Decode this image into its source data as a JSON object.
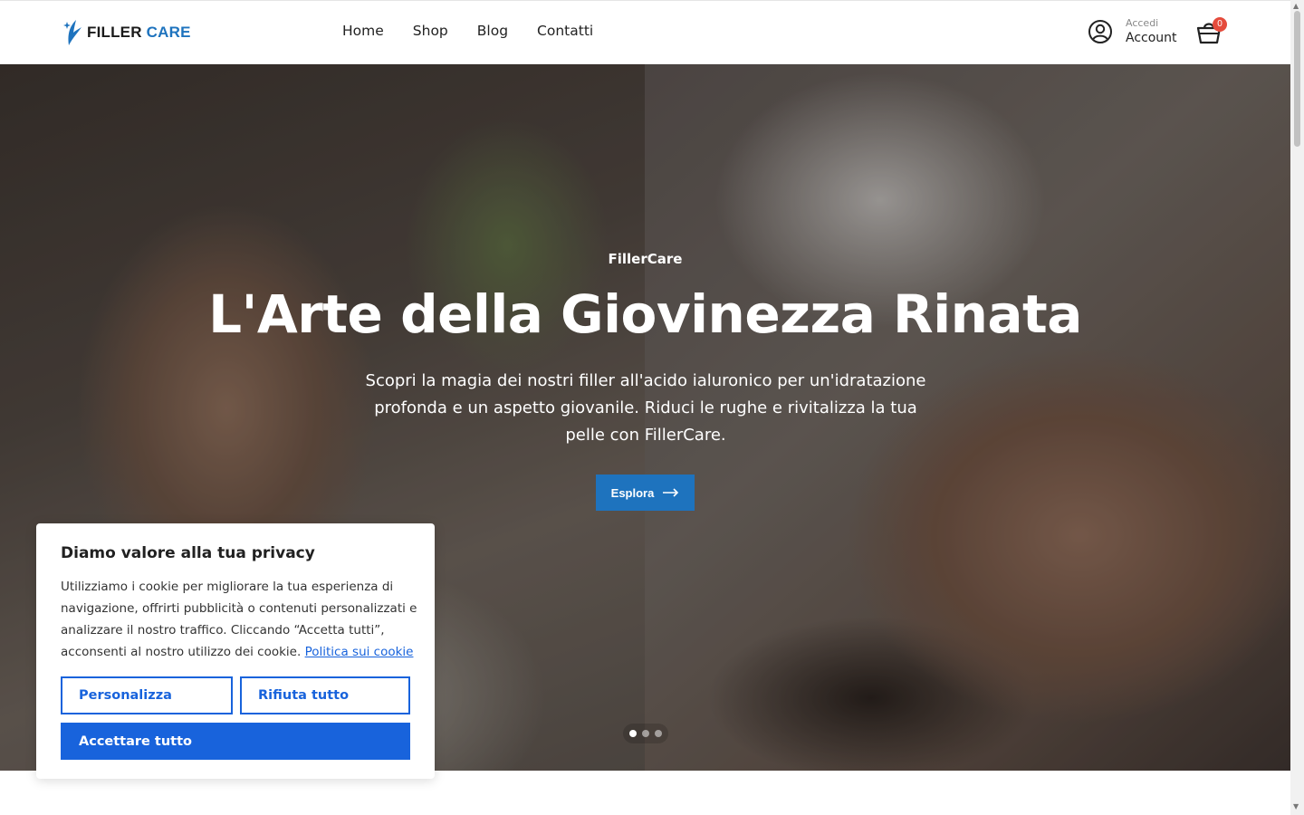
{
  "header": {
    "logo": {
      "word1": "FILLER",
      "word2": "CARE"
    },
    "nav": [
      "Home",
      "Shop",
      "Blog",
      "Contatti"
    ],
    "account": {
      "small_label": "Accedi",
      "label": "Account"
    },
    "cart": {
      "count": "0"
    }
  },
  "hero": {
    "eyebrow": "FillerCare",
    "title": "L'Arte della Giovinezza Rinata",
    "description": "Scopri la magia dei nostri filler all'acido ialuronico per un'idratazione profonda e un aspetto giovanile. Riduci le rughe e rivitalizza la tua pelle con FillerCare.",
    "cta": "Esplora",
    "slides": {
      "count": 3,
      "active": 1
    }
  },
  "cookie": {
    "title": "Diamo valore alla tua privacy",
    "text": "Utilizziamo i cookie per migliorare la tua esperienza di navigazione, offrirti pubblicità o contenuti personalizzati e analizzare il nostro traffico. Cliccando “Accetta tutti”, acconsenti al nostro utilizzo dei cookie.",
    "link": "Politica sui cookie",
    "customize": "Personalizza",
    "reject": "Rifiuta tutto",
    "accept": "Accettare tutto"
  },
  "colors": {
    "brand": "#1e73be",
    "cookie_blue": "#1863dc",
    "badge": "#e54b3c"
  }
}
